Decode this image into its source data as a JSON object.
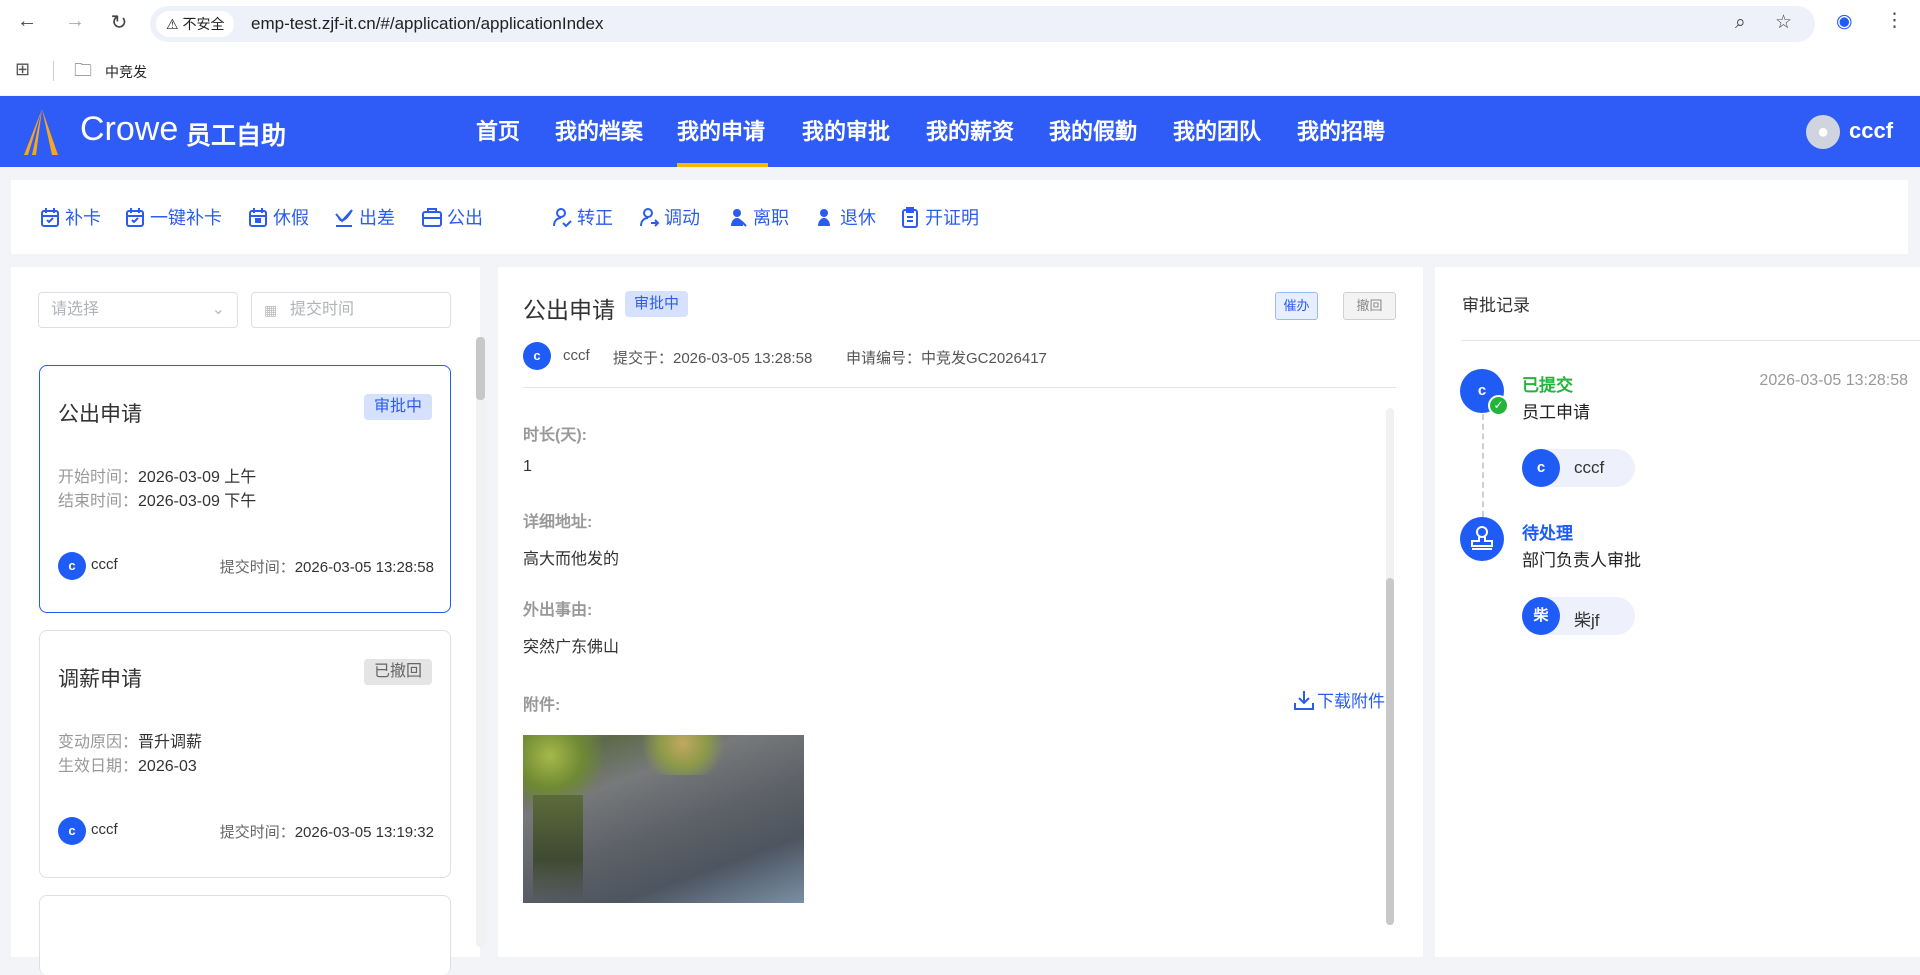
{
  "browser": {
    "insecure_label": "不安全",
    "url": "emp-test.zjf-it.cn/#/application/applicationIndex",
    "bookmark": "中竞发"
  },
  "header": {
    "brand": "Crowe",
    "app_name": "员工自助",
    "nav": [
      "首页",
      "我的档案",
      "我的申请",
      "我的审批",
      "我的薪资",
      "我的假勤",
      "我的团队",
      "我的招聘"
    ],
    "active_nav": "我的申请",
    "user": "cccf",
    "colors": {
      "header": "#2f5cf6",
      "underline": "#f5b800"
    }
  },
  "toolbar": {
    "items": [
      {
        "label": "补卡",
        "icon": "calendar-check-icon"
      },
      {
        "label": "一键补卡",
        "icon": "calendar-check-icon"
      },
      {
        "label": "休假",
        "icon": "calendar-leave-icon"
      },
      {
        "label": "出差",
        "icon": "plane-icon"
      },
      {
        "label": "公出",
        "icon": "briefcase-icon"
      },
      {
        "label": "转正",
        "icon": "user-check-icon"
      },
      {
        "label": "调动",
        "icon": "user-transfer-icon"
      },
      {
        "label": "离职",
        "icon": "user-leave-icon"
      },
      {
        "label": "退休",
        "icon": "user-retire-icon"
      },
      {
        "label": "开证明",
        "icon": "clipboard-icon"
      }
    ]
  },
  "list": {
    "select_placeholder": "请选择",
    "date_placeholder": "提交时间",
    "cards": [
      {
        "title": "公出申请",
        "status": "审批中",
        "lines": [
          {
            "k": "开始时间：",
            "v": "2026-03-09 上午"
          },
          {
            "k": "结束时间：",
            "v": "2026-03-09 下午"
          }
        ],
        "avatar": "c",
        "user": "cccf",
        "submit_label": "提交时间：",
        "submit_time": "2026-03-05 13:28:58"
      },
      {
        "title": "调薪申请",
        "status": "已撤回",
        "lines": [
          {
            "k": "变动原因：",
            "v": "晋升调薪"
          },
          {
            "k": "生效日期：",
            "v": "2026-03"
          }
        ],
        "avatar": "c",
        "user": "cccf",
        "submit_label": "提交时间：",
        "submit_time": "2026-03-05 13:19:32"
      }
    ]
  },
  "detail": {
    "title": "公出申请",
    "status": "审批中",
    "urge": "催办",
    "withdraw": "撤回",
    "avatar": "c",
    "user": "cccf",
    "submitted": "提交于：2026-03-05 13:28:58",
    "number": "申请编号：中竞发GC2026417",
    "fields": [
      {
        "label": "时长(天):",
        "value": "1"
      },
      {
        "label": "详细地址:",
        "value": "高大而他发的"
      },
      {
        "label": "外出事由:",
        "value": "突然广东佛山"
      }
    ],
    "attachment_label": "附件:",
    "download": "下载附件"
  },
  "record": {
    "title": "审批记录",
    "steps": [
      {
        "status": "已提交",
        "status_color": "#22b53a",
        "desc": "员工申请",
        "time": "2026-03-05 13:28:58",
        "avatar": "c",
        "person_avatar": "c",
        "person": "cccf"
      },
      {
        "status": "待处理",
        "status_color": "#1f5bf5",
        "desc": "部门负责人审批",
        "avatar_icon": "stamp-icon",
        "person_avatar": "柴",
        "person": "柴jf"
      }
    ]
  }
}
